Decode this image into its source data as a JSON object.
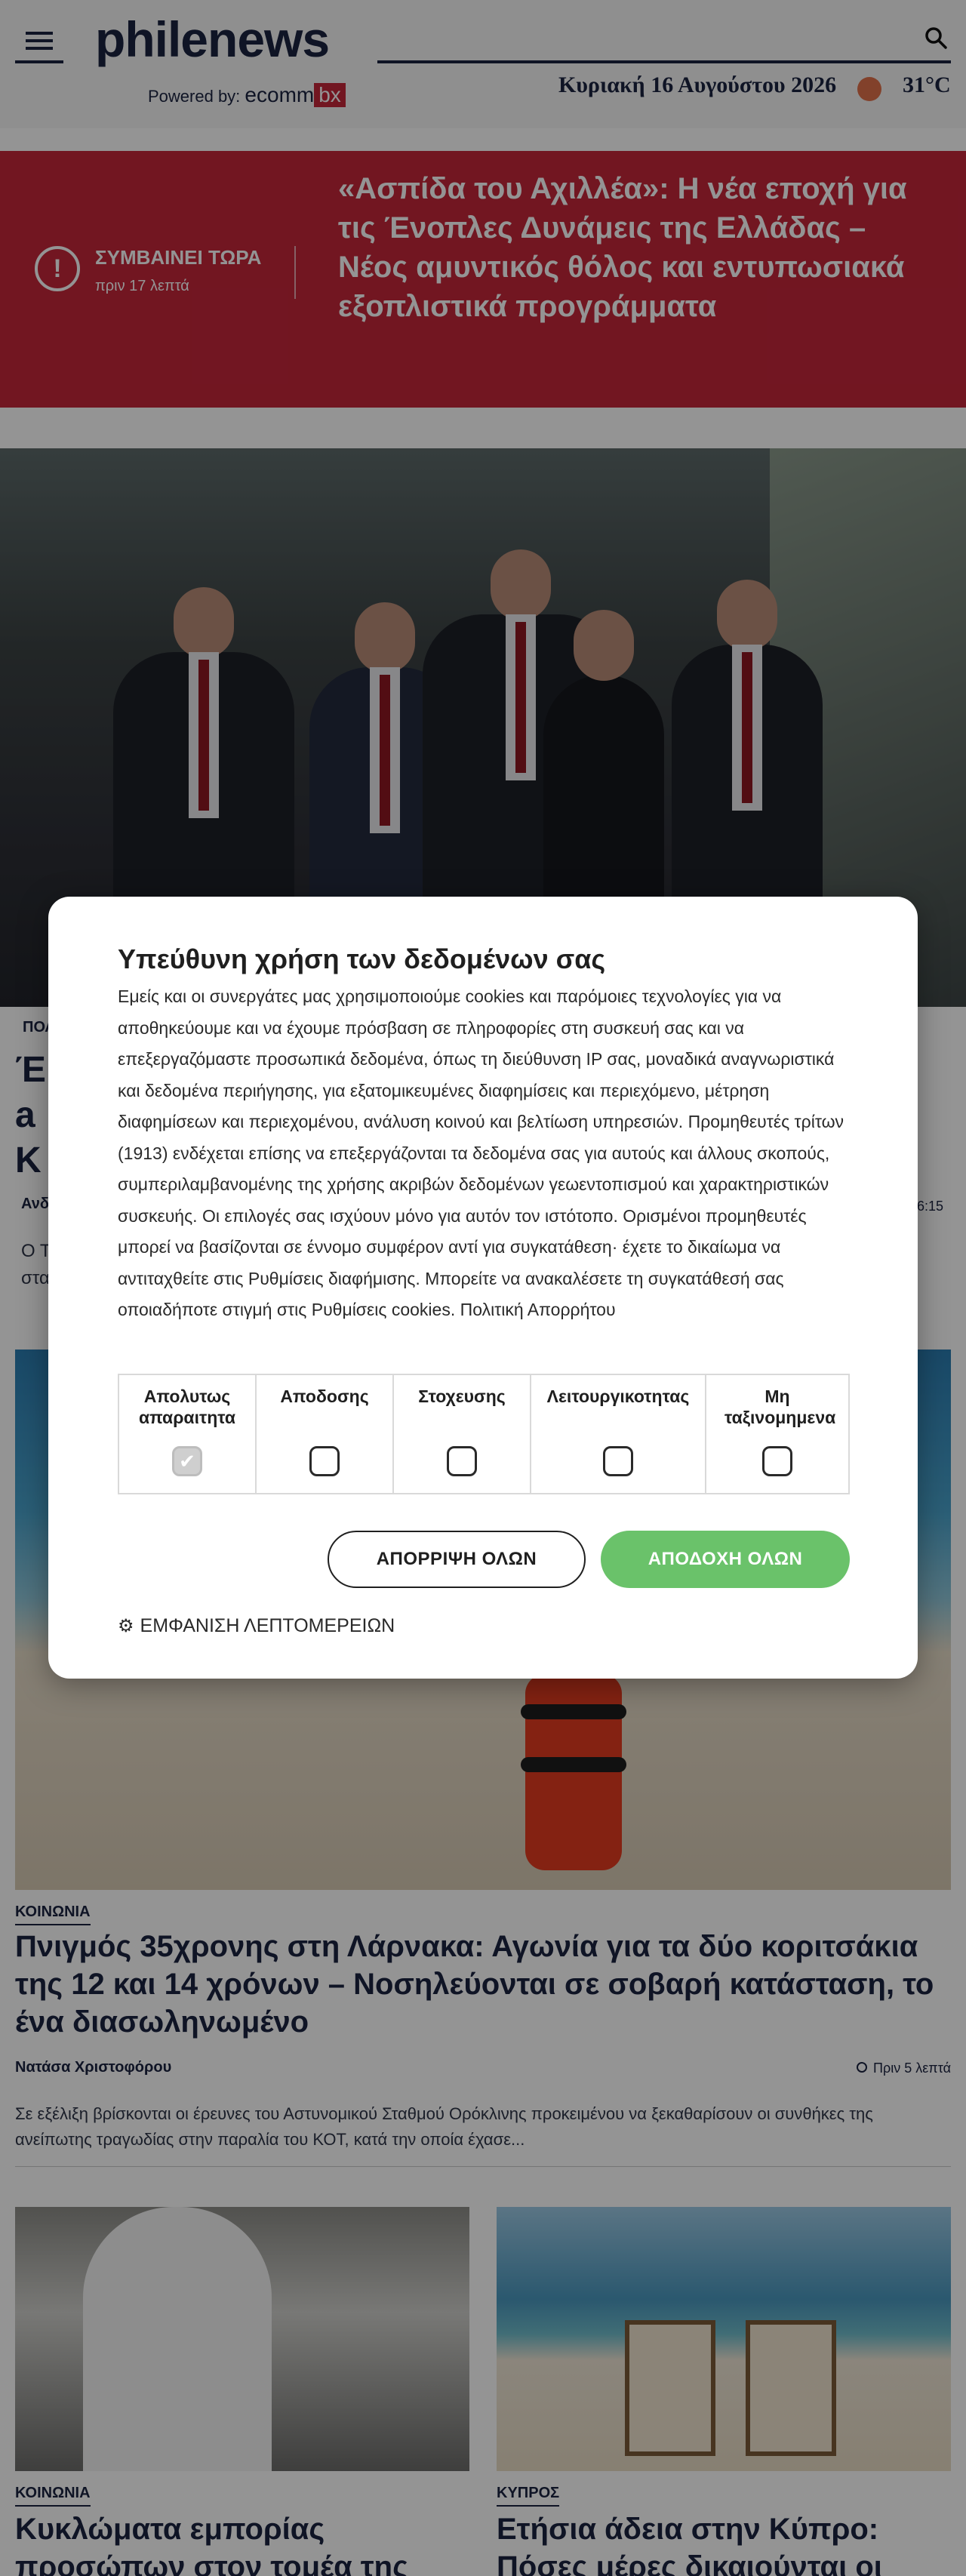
{
  "header": {
    "logo": "philenews",
    "powered_by": "Powered by:",
    "ecomm": "ecomm",
    "bx": "bx",
    "date": "Κυριακή 16 Αυγούστου 2026",
    "temperature": "31°C"
  },
  "breaking": {
    "label": "ΣΥΜΒΑΙΝΕΙ ΤΩΡΑ",
    "time": "πριν 17 λεπτά",
    "headline": "«Ασπίδα του Αχιλλέα»: Η νέα εποχή για τις Ένοπλες Δυνάμεις της Ελλάδας – Νέος αμυντικός θόλος και εντυπωσιακά εξοπλιστικά προγράμματα"
  },
  "hidden_article": {
    "category": "ΠΟΛ",
    "headline": "Έ\na\nK",
    "author": "Ανδ",
    "time": "6:15",
    "excerpt": "Ο Τ                                                                                                                 ος\nστα"
  },
  "article2": {
    "category": "ΚΟΙΝΩΝΙΑ",
    "headline": "Πνιγμός 35χρονης στη Λάρνακα: Αγωνία για τα δύο κοριτσάκια της 12 και 14 χρόνων – Νοσηλεύονται σε σοβαρή κατάσταση, το ένα διασωληνωμένο",
    "author": "Νατάσα Χριστοφόρου",
    "time": "Πριν 5 λεπτά",
    "excerpt": "Σε εξέλιξη βρίσκονται οι έρευνες του Αστυνομικού Σταθμού Ορόκλινης προκειμένου να ξεκαθαρίσουν οι συνθήκες της ανείπωτης τραγωδίας στην παραλία του ΚΟΤ, κατά την οποία έχασε..."
  },
  "cards": [
    {
      "category": "ΚΟΙΝΩΝΙΑ",
      "title": "Κυκλώματα εμπορίας προσώπων στον τομέα της"
    },
    {
      "category": "ΚΥΠΡΟΣ",
      "title": "Ετήσια άδεια στην Κύπρο: Πόσες μέρες δικαιούνται οι"
    }
  ],
  "cookie_modal": {
    "title": "Υπεύθυνη χρήση των δεδομένων σας",
    "body": "Εμείς και οι συνεργάτες μας χρησιμοποιούμε cookies και παρόμοιες τεχνολογίες για να αποθηκεύουμε και να έχουμε πρόσβαση σε πληροφορίες στη συσκευή σας και να επεξεργαζόμαστε προσωπικά δεδομένα, όπως τη διεύθυνση IP σας, μοναδικά αναγνωριστικά και δεδομένα περιήγησης, για εξατομικευμένες διαφημίσεις και περιεχόμενο, μέτρηση διαφημίσεων και περιεχομένου, ανάλυση κοινού και βελτίωση υπηρεσιών. Προμηθευτές τρίτων (1913) ενδέχεται επίσης να επεξεργάζονται τα δεδομένα σας για αυτούς και άλλους σκοπούς, συμπεριλαμβανομένης της χρήσης ακριβών δεδομένων γεωεντοπισμού και χαρακτηριστικών συσκευής. Οι επιλογές σας ισχύουν μόνο για αυτόν τον ιστότοπο. Ορισμένοι προμηθευτές μπορεί να βασίζονται σε έννομο συμφέρον αντί για συγκατάθεση· έχετε το δικαίωμα να αντιταχθείτε στις Ρυθμίσεις διαφήμισης. Μπορείτε να ανακαλέσετε τη συγκατάθεσή σας οποιαδήποτε στιγμή στις Ρυθμίσεις cookies.",
    "policy_link": "Πολιτική Απορρήτου",
    "categories": [
      {
        "label": "Απολυτως απαραιτητα",
        "checked": true
      },
      {
        "label": "Αποδοσης",
        "checked": false
      },
      {
        "label": "Στοχευσης",
        "checked": false
      },
      {
        "label": "Λειτουργικοτητας",
        "checked": false
      },
      {
        "label": "Μη ταξινομημενα",
        "checked": false
      }
    ],
    "reject_label": "ΑΠΟΡΡΙΨΗ ΟΛΩΝ",
    "accept_label": "ΑΠΟΔΟΧΗ ΟΛΩΝ",
    "details_label": "ΕΜΦΑΝΙΣΗ ΛΕΠΤΟΜΕΡΕΙΩΝ"
  },
  "colors": {
    "brand_navy": "#1b2340",
    "breaking_red": "#c4263a",
    "accept_green": "#6ac26a"
  }
}
